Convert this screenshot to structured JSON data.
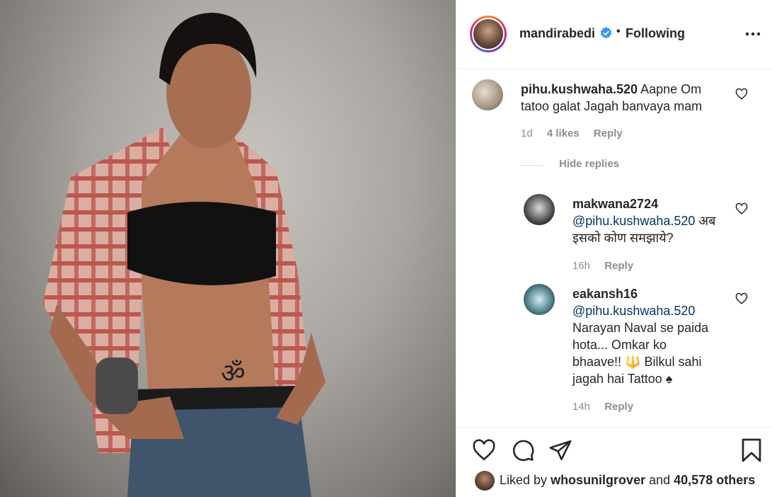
{
  "post": {
    "image_alt": "",
    "tattoo_glyph": "ॐ"
  },
  "header": {
    "username": "mandirabedi",
    "separator": "•",
    "following_label": "Following",
    "more_icon": "more-horizontal-icon",
    "verified_icon": "verified-badge-icon"
  },
  "comments": [
    {
      "username": "pihu.kushwaha.520",
      "text_line1": "Aapne Om",
      "text_line2": "tatoo galat Jagah banvaya mam",
      "time": "1d",
      "likes": "4 likes",
      "reply_label": "Reply"
    }
  ],
  "replies_toggle": "Hide replies",
  "replies": [
    {
      "username": "makwana2724",
      "mention": "@pihu.kushwaha.520",
      "text_after_mention": "अब",
      "text_line2": "इसको कोण समझाये?",
      "time": "16h",
      "reply_label": "Reply"
    },
    {
      "username": "eakansh16",
      "mention": "@pihu.kushwaha.520",
      "text_line1": "Narayan Naval se paida",
      "text_line2": "hota... Omkar ko",
      "text_line3": "bhaave!! 🔱 Bilkul sahi",
      "text_line4": "jagah hai Tattoo ♠",
      "time": "14h",
      "reply_label": "Reply"
    }
  ],
  "actions": {
    "like_icon": "heart-icon",
    "comment_icon": "comment-icon",
    "share_icon": "share-icon",
    "save_icon": "bookmark-icon"
  },
  "likes": {
    "prefix": "Liked by",
    "user": "whosunilgrover",
    "middle": "and",
    "count": "40,578 others"
  }
}
